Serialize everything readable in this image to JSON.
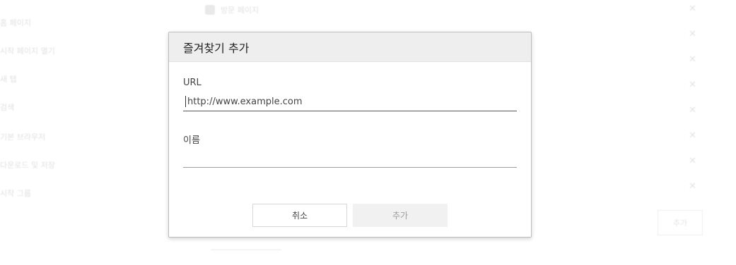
{
  "background": {
    "top_item_label": "방문 페이지",
    "side_items": [
      "홈 페이지",
      "시작 페이지 열기",
      "새 탭",
      "검색",
      "기본 브라우저",
      "다운로드 및 저장",
      "시작 그룹"
    ],
    "close_glyph": "✕",
    "button_label": "추가"
  },
  "dialog": {
    "title": "즐겨찾기 추가",
    "url_label": "URL",
    "url_placeholder": "http://www.example.com",
    "url_value": "",
    "name_label": "이름",
    "name_value": "",
    "cancel_label": "취소",
    "add_label": "추가"
  },
  "colors": {
    "header_bg": "#eeeeee",
    "disabled_button_bg": "#f1f1f1",
    "disabled_text": "#9e9e9e"
  }
}
